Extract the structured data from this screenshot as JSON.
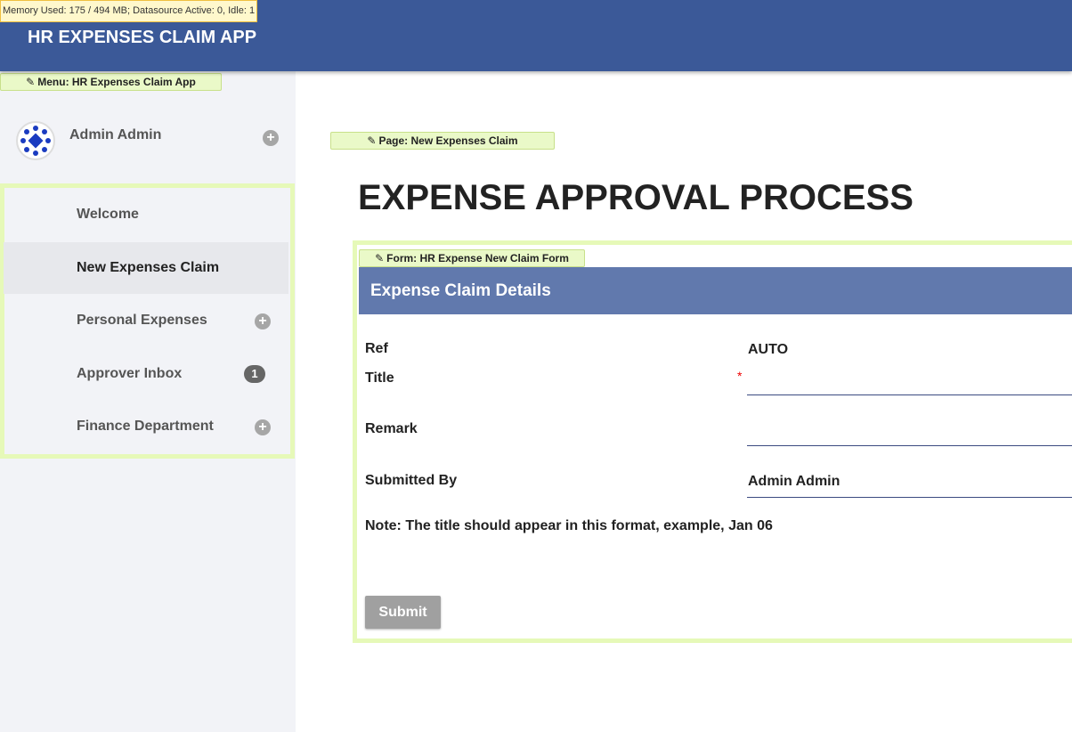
{
  "debug": {
    "memory": "Memory Used: 175 / 494 MB; Datasource Active: 0, Idle: 1"
  },
  "header": {
    "title": "HR EXPENSES CLAIM APP"
  },
  "sidebar": {
    "menu_tag": "Menu: HR Expenses Claim App",
    "user_name": "Admin Admin",
    "items": [
      {
        "label": "Welcome"
      },
      {
        "label": "New Expenses Claim"
      },
      {
        "label": "Personal Expenses"
      },
      {
        "label": "Approver Inbox",
        "badge": "1"
      },
      {
        "label": "Finance Department"
      }
    ]
  },
  "page": {
    "tag": "Page: New Expenses Claim",
    "title": "EXPENSE APPROVAL PROCESS"
  },
  "form": {
    "tag": "Form: HR Expense New Claim Form",
    "header": "Expense Claim Details",
    "ref_label": "Ref",
    "ref_value": "AUTO",
    "title_label": "Title",
    "required_mark": "*",
    "remark_label": "Remark",
    "submitted_by_label": "Submitted By",
    "submitted_by_value": "Admin Admin",
    "note": "Note: The title should appear in this format, example, Jan 06",
    "submit_label": "Submit"
  }
}
